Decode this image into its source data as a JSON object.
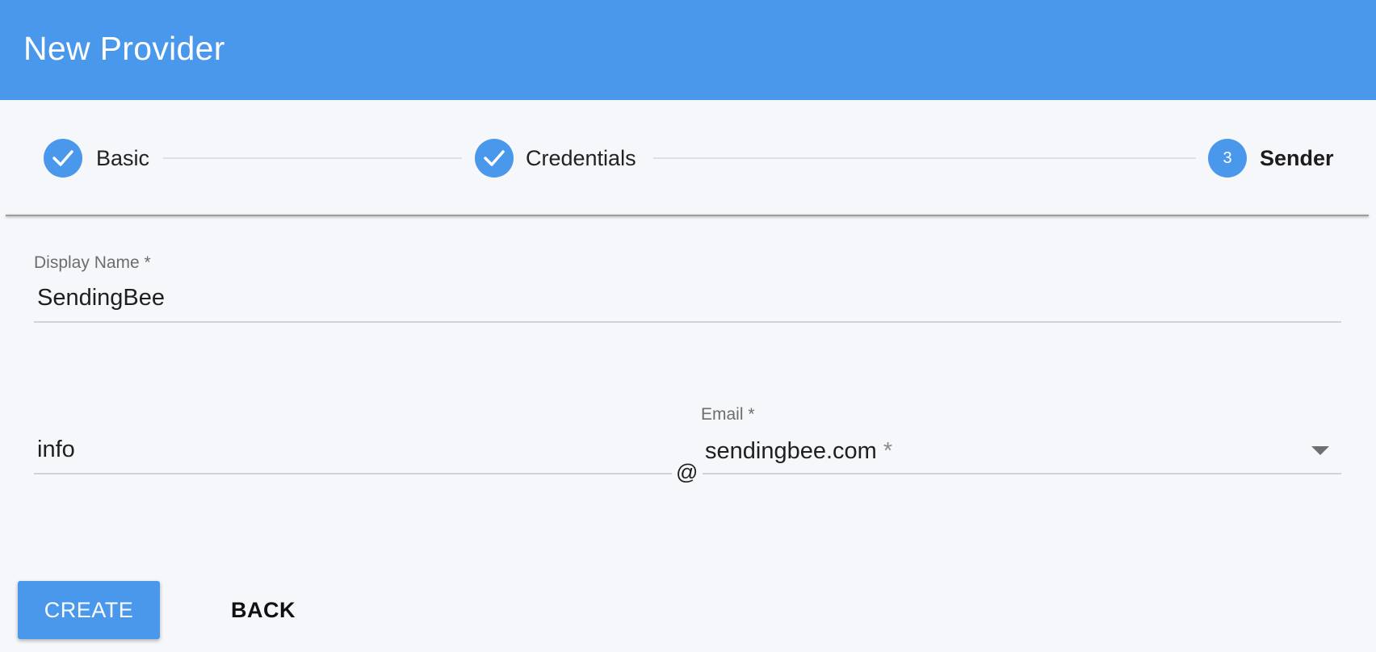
{
  "header": {
    "title": "New Provider",
    "color": "#4a98ec"
  },
  "stepper": {
    "steps": [
      {
        "label": "Basic",
        "state": "completed",
        "icon": "check-icon"
      },
      {
        "label": "Credentials",
        "state": "completed",
        "icon": "check-icon"
      },
      {
        "label": "Sender",
        "state": "active",
        "number": "3"
      }
    ]
  },
  "form": {
    "display_name": {
      "label": "Display Name *",
      "value": "SendingBee"
    },
    "sender_local_part": {
      "value": "info"
    },
    "at_sign": "@",
    "email_domain": {
      "label": "Email *",
      "value": "sendingbee.com",
      "required_marker": "*",
      "icon": "dropdown-arrow-icon"
    }
  },
  "actions": {
    "create_label": "CREATE",
    "back_label": "BACK"
  }
}
